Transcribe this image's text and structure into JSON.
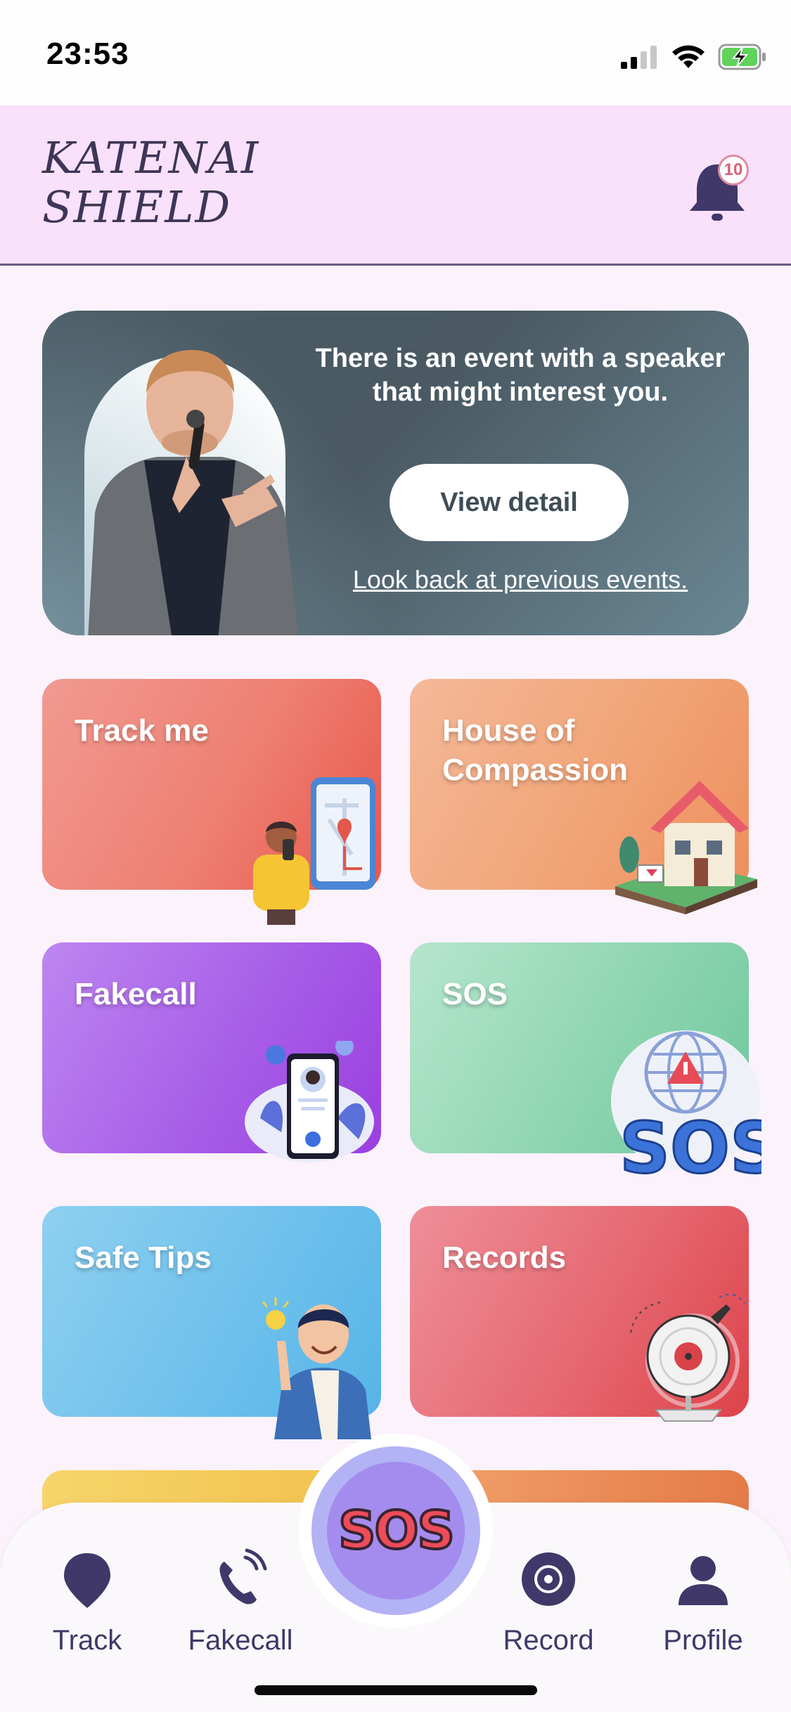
{
  "status_bar": {
    "time": "23:53"
  },
  "header": {
    "logo_line1": "KATENAI",
    "logo_line2": "SHIELD",
    "notification_count": "10"
  },
  "event": {
    "message": "There is an event with a speaker that might interest you.",
    "button_label": "View detail",
    "link_text": "Look back at previous events."
  },
  "cards": {
    "track": "Track me",
    "house": "House of Compassion",
    "fakecall": "Fakecall",
    "sos": "SOS",
    "tips": "Safe Tips",
    "records": "Records"
  },
  "nav": {
    "track": "Track",
    "fakecall": "Fakecall",
    "sos": "SOS",
    "record": "Record",
    "profile": "Profile"
  },
  "colors": {
    "header_bg": "#f9e0fb",
    "accent": "#3f3869",
    "sos_button": "#a48cee"
  }
}
